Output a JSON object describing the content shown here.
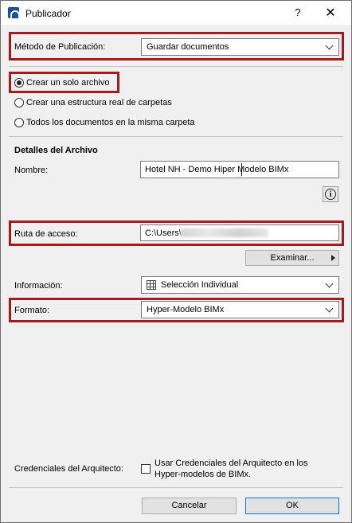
{
  "window": {
    "title": "Publicador",
    "help": "?",
    "close": "✕"
  },
  "publish_method": {
    "label": "Método de Publicación:",
    "value": "Guardar documentos"
  },
  "output_mode": {
    "options": [
      {
        "label": "Crear un solo archivo",
        "checked": true
      },
      {
        "label": "Crear una estructura real de carpetas",
        "checked": false
      },
      {
        "label": "Todos los documentos en la misma carpeta",
        "checked": false
      }
    ]
  },
  "file_details": {
    "heading": "Detalles del Archivo",
    "name_label": "Nombre:",
    "name_value_before_caret": "Hotel NH - Demo Hiper ",
    "name_value_after_caret": "Modelo BIMx",
    "info_icon": "i"
  },
  "path": {
    "label": "Ruta de acceso:",
    "value_prefix": "C:\\Users\\",
    "browse_label": "Examinar..."
  },
  "information": {
    "label": "Información:",
    "value": "Selección Individual"
  },
  "format": {
    "label": "Formato:",
    "value": "Hyper-Modelo BIMx"
  },
  "credentials": {
    "label": "Credenciales del Arquitecto:",
    "checkbox_line1": "Usar Credenciales del Arquitecto en los",
    "checkbox_line2": "Hyper-modelos de BIMx.",
    "checked": false
  },
  "footer": {
    "cancel_label": "Cancelar",
    "ok_label": "OK"
  },
  "colors": {
    "highlight": "#a31b1f",
    "window_bg": "#f0f0f0"
  }
}
